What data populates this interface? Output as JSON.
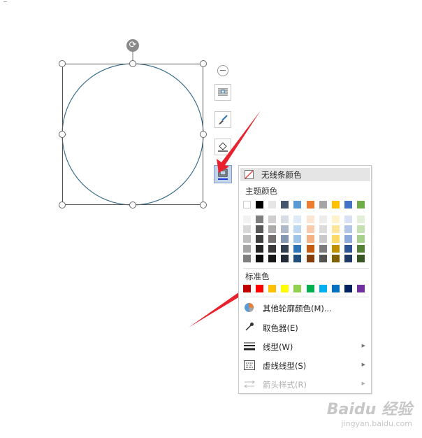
{
  "menu": {
    "no_line_label": "无线条颜色",
    "theme_label": "主题颜色",
    "standard_label": "标准色",
    "more_colors_label": "其他轮廓颜色(M)...",
    "eyedropper_label": "取色器(E)",
    "line_style_label": "线型(W)",
    "dash_style_label": "虚线线型(S)",
    "arrow_style_label": "箭头样式(R)"
  },
  "theme_colors": [
    "#ffffff",
    "#000000",
    "#e7e6e6",
    "#44546a",
    "#5b9bd5",
    "#ed7d31",
    "#a5a5a5",
    "#ffc000",
    "#4472c4",
    "#70ad47"
  ],
  "theme_shades": [
    [
      "#f2f2f2",
      "#7f7f7f",
      "#d0cece",
      "#d6dce4",
      "#deebf6",
      "#fbe5d5",
      "#ededed",
      "#fff2cc",
      "#d9e2f3",
      "#e2efd9"
    ],
    [
      "#d8d8d8",
      "#595959",
      "#aeabab",
      "#adb9ca",
      "#bdd7ee",
      "#f7cbac",
      "#dbdbdb",
      "#fee599",
      "#b4c6e7",
      "#c5e0b3"
    ],
    [
      "#bfbfbf",
      "#3f3f3f",
      "#757070",
      "#8497b0",
      "#9dc3e6",
      "#f4b183",
      "#c9c9c9",
      "#ffd965",
      "#8eaadb",
      "#a8d08d"
    ],
    [
      "#a5a5a5",
      "#262626",
      "#3a3838",
      "#323f4f",
      "#2e75b5",
      "#c55a11",
      "#7b7b7b",
      "#bf9000",
      "#2f5496",
      "#538135"
    ],
    [
      "#7f7f7f",
      "#0c0c0c",
      "#171616",
      "#222a35",
      "#1e4e79",
      "#833c0b",
      "#525252",
      "#7f6000",
      "#1f3864",
      "#375623"
    ]
  ],
  "standard_colors": [
    "#c00000",
    "#ff0000",
    "#ffc000",
    "#ffff00",
    "#92d050",
    "#00b050",
    "#00b0f0",
    "#0070c0",
    "#002060",
    "#7030a0"
  ],
  "watermark": {
    "brand": "Baidu 经验",
    "url": "jingyan.baidu.com"
  }
}
